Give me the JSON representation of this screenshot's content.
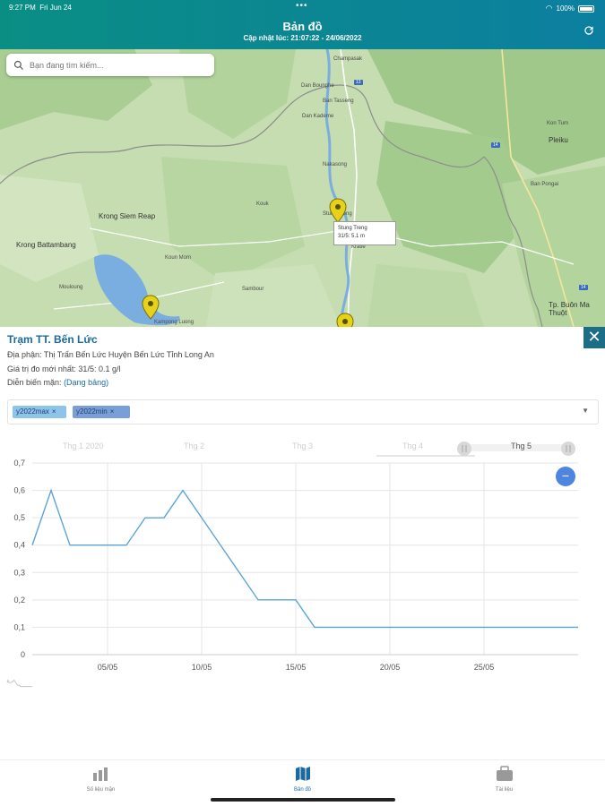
{
  "status": {
    "time": "9:27 PM",
    "date": "Fri Jun 24",
    "battery": "100%"
  },
  "header": {
    "title": "Bản đồ",
    "subtitle": "Cập nhật lúc: 21:07:22 - 24/06/2022"
  },
  "search": {
    "placeholder": "Bạn đang tìm kiếm..."
  },
  "map": {
    "labels": [
      "Champasak",
      "Dan Bounghe",
      "Ban Tasseng",
      "Dan Kaderne",
      "Nakasong",
      "Stung Treng",
      "Kratie",
      "Krong Siem Reap",
      "Krong Battambang",
      "Kouk",
      "Sambour",
      "Kampong Luong",
      "Pleiku",
      "Tp. Buôn Ma Thuột",
      "Kon Tum",
      "Ban Pongai",
      "Mouloung",
      "Koun Mom"
    ],
    "tooltip": {
      "title": "Stung Treng",
      "value": "31/5: 5.1 m"
    }
  },
  "station": {
    "name": "Trạm TT. Bến Lức",
    "location": "Địa phận: Thị Trấn Bến Lức Huyện Bến Lức Tỉnh Long An",
    "latest": "Giá trị đo mới nhất: 31/5: 0.1 g/l",
    "trend_label": "Diễn biến mặn:",
    "trend_link": "(Dạng bảng)"
  },
  "filter": {
    "tags": [
      "y2022max",
      "y2022min"
    ]
  },
  "navigator": {
    "labels": [
      "Thg 1 2020",
      "Thg 2",
      "Thg 3",
      "Thg 4",
      "Thg 5"
    ]
  },
  "chart_data": {
    "type": "line",
    "x_ticks": [
      "05/05",
      "10/05",
      "15/05",
      "20/05",
      "25/05"
    ],
    "y_ticks": [
      0,
      0.1,
      0.2,
      0.3,
      0.4,
      0.5,
      0.6,
      0.7
    ],
    "ylim": [
      0,
      0.7
    ],
    "xlim": [
      1,
      30
    ],
    "grid": true,
    "series": [
      {
        "name": "y2022max",
        "color": "#5aa5d8",
        "x": [
          1,
          2,
          3,
          4,
          5,
          6,
          7,
          8,
          9,
          10,
          11,
          12,
          13,
          14,
          15,
          16,
          17,
          18,
          19,
          20,
          21,
          22,
          23,
          24,
          25,
          26,
          27,
          28,
          29,
          30
        ],
        "y": [
          0.4,
          0.6,
          0.4,
          0.4,
          0.4,
          0.4,
          0.5,
          0.5,
          0.6,
          0.5,
          0.4,
          0.3,
          0.2,
          0.2,
          0.2,
          0.1,
          0.1,
          0.1,
          0.1,
          0.1,
          0.1,
          0.1,
          0.1,
          0.1,
          0.1,
          0.1,
          0.1,
          0.1,
          0.1,
          0.1
        ]
      }
    ]
  },
  "tabs": [
    {
      "label": "Số liệu mặn"
    },
    {
      "label": "Bản đồ"
    },
    {
      "label": "Tài liệu"
    }
  ],
  "colors": {
    "header": "#0a8e84",
    "accent": "#1a6aa0",
    "line": "#5aa5d8"
  }
}
